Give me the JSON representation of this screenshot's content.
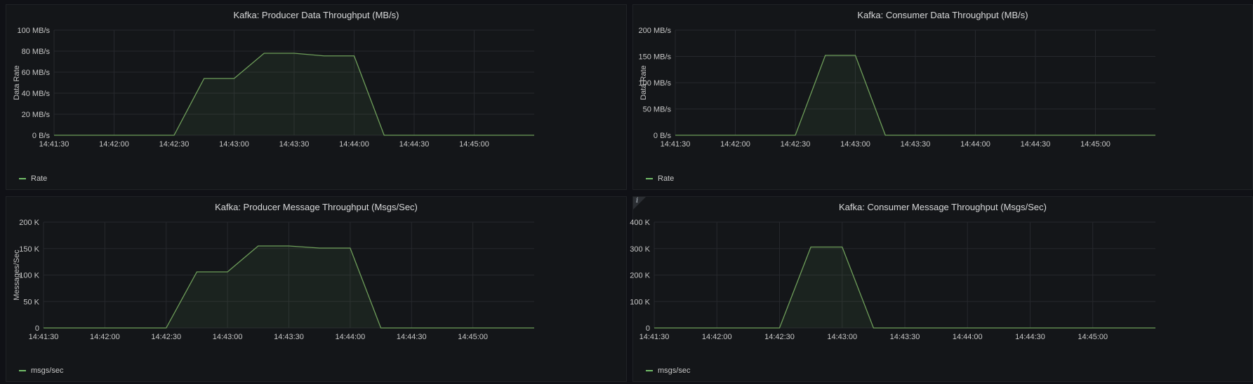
{
  "colors": {
    "series": "#6e9e5a",
    "fill": "rgba(115,191,105,0.08)",
    "grid": "#26282d",
    "axis": "#c7c7c7"
  },
  "chart_data": [
    {
      "type": "area",
      "title": "Kafka: Producer Data Throughput (MB/s)",
      "ylabel": "Data Rate",
      "xlabel": "",
      "grid": true,
      "legend_position": "bottom-left",
      "x_ticks": [
        "14:41:30",
        "14:42:00",
        "14:42:30",
        "14:43:00",
        "14:43:30",
        "14:44:00",
        "14:44:30",
        "14:45:00"
      ],
      "y_ticks": [
        "0 B/s",
        "20 MB/s",
        "40 MB/s",
        "60 MB/s",
        "80 MB/s",
        "100 MB/s"
      ],
      "ylim": [
        0,
        100
      ],
      "xlim": [
        "14:41:30",
        "14:45:30"
      ],
      "series": [
        {
          "name": "Rate",
          "x": [
            "14:41:30",
            "14:42:30",
            "14:42:45",
            "14:43:00",
            "14:43:15",
            "14:43:30",
            "14:43:45",
            "14:44:00",
            "14:44:15",
            "14:45:30"
          ],
          "values": [
            0,
            0,
            54,
            54,
            78,
            78,
            75.5,
            75.5,
            0,
            0
          ]
        }
      ]
    },
    {
      "type": "area",
      "title": "Kafka: Consumer Data Throughput (MB/s)",
      "ylabel": "Data Rate",
      "xlabel": "",
      "grid": true,
      "legend_position": "bottom-left",
      "x_ticks": [
        "14:41:30",
        "14:42:00",
        "14:42:30",
        "14:43:00",
        "14:43:30",
        "14:44:00",
        "14:44:30",
        "14:45:00"
      ],
      "y_ticks": [
        "0 B/s",
        "50 MB/s",
        "100 MB/s",
        "150 MB/s",
        "200 MB/s"
      ],
      "ylim": [
        0,
        200
      ],
      "xlim": [
        "14:41:30",
        "14:45:30"
      ],
      "series": [
        {
          "name": "Rate",
          "x": [
            "14:41:30",
            "14:42:30",
            "14:42:45",
            "14:43:00",
            "14:43:15",
            "14:45:30"
          ],
          "values": [
            0,
            0,
            152,
            152,
            0,
            0
          ]
        }
      ]
    },
    {
      "type": "area",
      "title": "Kafka: Producer Message Throughput (Msgs/Sec)",
      "ylabel": "Messages/Sec",
      "xlabel": "",
      "grid": true,
      "legend_position": "bottom-left",
      "x_ticks": [
        "14:41:30",
        "14:42:00",
        "14:42:30",
        "14:43:00",
        "14:43:30",
        "14:44:00",
        "14:44:30",
        "14:45:00"
      ],
      "y_ticks": [
        "0",
        "50 K",
        "100 K",
        "150 K",
        "200 K"
      ],
      "ylim": [
        0,
        200
      ],
      "xlim": [
        "14:41:30",
        "14:45:30"
      ],
      "series": [
        {
          "name": "msgs/sec",
          "x": [
            "14:41:30",
            "14:42:30",
            "14:42:45",
            "14:43:00",
            "14:43:15",
            "14:43:30",
            "14:43:45",
            "14:44:00",
            "14:44:15",
            "14:45:30"
          ],
          "values": [
            0,
            0,
            106,
            106,
            155,
            155,
            151,
            151,
            0,
            0
          ]
        }
      ]
    },
    {
      "type": "area",
      "title": "Kafka: Consumer Message Throughput (Msgs/Sec)",
      "ylabel": "",
      "xlabel": "",
      "grid": true,
      "legend_position": "bottom-left",
      "x_ticks": [
        "14:41:30",
        "14:42:00",
        "14:42:30",
        "14:43:00",
        "14:43:30",
        "14:44:00",
        "14:44:30",
        "14:45:00"
      ],
      "y_ticks": [
        "0",
        "100 K",
        "200 K",
        "300 K",
        "400 K"
      ],
      "ylim": [
        0,
        400
      ],
      "xlim": [
        "14:41:30",
        "14:45:30"
      ],
      "series": [
        {
          "name": "msgs/sec",
          "x": [
            "14:41:30",
            "14:42:30",
            "14:42:45",
            "14:43:00",
            "14:43:15",
            "14:45:30"
          ],
          "values": [
            0,
            0,
            306,
            306,
            0,
            0
          ]
        }
      ]
    }
  ],
  "info_icon": "info-icon"
}
